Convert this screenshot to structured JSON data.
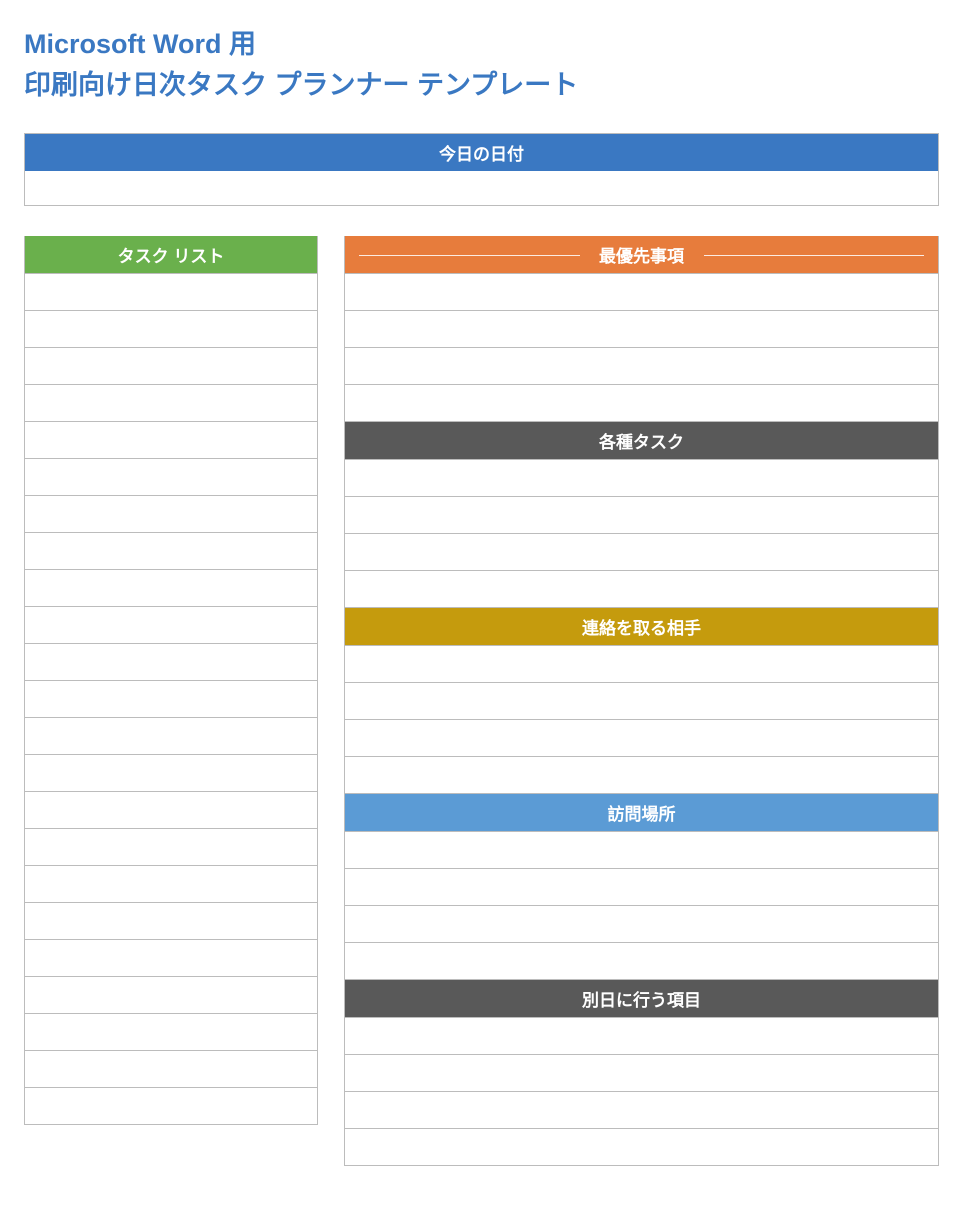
{
  "title_line1": "Microsoft Word 用",
  "title_line2": "印刷向け日次タスク プランナー テンプレート",
  "date_header": "今日の日付",
  "sections": {
    "task_list": {
      "label": "タスク リスト",
      "rows": 23
    },
    "top_priority": {
      "label": "最優先事項",
      "rows": 4
    },
    "various_tasks": {
      "label": "各種タスク",
      "rows": 4
    },
    "contacts": {
      "label": "連絡を取る相手",
      "rows": 4
    },
    "places": {
      "label": "訪問場所",
      "rows": 4
    },
    "another_day": {
      "label": "別日に行う項目",
      "rows": 4
    }
  }
}
